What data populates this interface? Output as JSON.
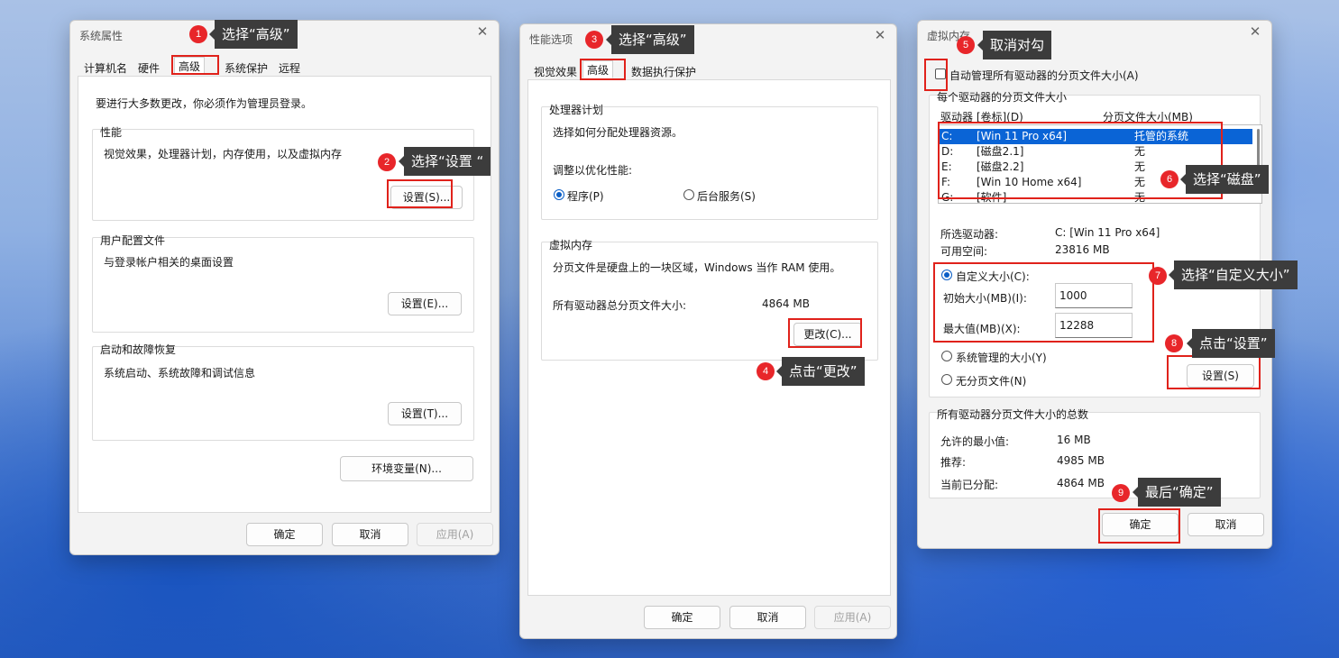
{
  "win1": {
    "title": "系统属性",
    "close": "✕",
    "tabs": [
      "计算机名",
      "硬件",
      "高级",
      "系统保护",
      "远程"
    ],
    "admin_note": "要进行大多数更改，你必须作为管理员登录。",
    "perf": {
      "title": "性能",
      "desc": "视觉效果，处理器计划，内存使用，以及虚拟内存",
      "button": "设置(S)..."
    },
    "profile": {
      "title": "用户配置文件",
      "desc": "与登录帐户相关的桌面设置",
      "button": "设置(E)..."
    },
    "startup": {
      "title": "启动和故障恢复",
      "desc": "系统启动、系统故障和调试信息",
      "button": "设置(T)..."
    },
    "env_button": "环境变量(N)...",
    "ok": "确定",
    "cancel": "取消",
    "apply": "应用(A)"
  },
  "win2": {
    "title": "性能选项",
    "close": "✕",
    "tabs": [
      "视觉效果",
      "高级",
      "数据执行保护"
    ],
    "sched": {
      "title": "处理器计划",
      "desc": "选择如何分配处理器资源。",
      "adjust": "调整以优化性能:",
      "opt_programs": "程序(P)",
      "opt_background": "后台服务(S)"
    },
    "vm": {
      "title": "虚拟内存",
      "desc": "分页文件是硬盘上的一块区域，Windows 当作 RAM 使用。",
      "total_label": "所有驱动器总分页文件大小:",
      "total_value": "4864 MB",
      "button": "更改(C)..."
    },
    "ok": "确定",
    "cancel": "取消",
    "apply": "应用(A)"
  },
  "win3": {
    "title": "虚拟内存",
    "close": "✕",
    "auto_manage": "自动管理所有驱动器的分页文件大小(A)",
    "per_drive": "每个驱动器的分页文件大小",
    "col_drive": "驱动器 [卷标](D)",
    "col_size": "分页文件大小(MB)",
    "drives": [
      {
        "letter": "C:",
        "label": "[Win 11 Pro x64]",
        "size": "托管的系统"
      },
      {
        "letter": "D:",
        "label": "[磁盘2.1]",
        "size": "无"
      },
      {
        "letter": "E:",
        "label": "[磁盘2.2]",
        "size": "无"
      },
      {
        "letter": "F:",
        "label": "[Win 10 Home x64]",
        "size": "无"
      },
      {
        "letter": "G:",
        "label": "[软件]",
        "size": "无"
      }
    ],
    "selected_label": "所选驱动器:",
    "selected_value": "C:  [Win 11 Pro x64]",
    "free_label": "可用空间:",
    "free_value": "23816 MB",
    "custom": "自定义大小(C):",
    "initial_label": "初始大小(MB)(I):",
    "initial_value": "1000",
    "max_label": "最大值(MB)(X):",
    "max_value": "12288",
    "system_managed": "系统管理的大小(Y)",
    "no_paging": "无分页文件(N)",
    "set_button": "设置(S)",
    "totals_title": "所有驱动器分页文件大小的总数",
    "min_label": "允许的最小值:",
    "min_value": "16 MB",
    "rec_label": "推荐:",
    "rec_value": "4985 MB",
    "cur_label": "当前已分配:",
    "cur_value": "4864 MB",
    "ok": "确定",
    "cancel": "取消"
  },
  "annotations": [
    {
      "num": "1",
      "text": "选择“高级”"
    },
    {
      "num": "2",
      "text": "选择“设置 “"
    },
    {
      "num": "3",
      "text": "选择“高级”"
    },
    {
      "num": "4",
      "text": "点击“更改”"
    },
    {
      "num": "5",
      "text": "取消对勾"
    },
    {
      "num": "6",
      "text": "选择“磁盘”"
    },
    {
      "num": "7",
      "text": "选择“自定义大小”"
    },
    {
      "num": "8",
      "text": "点击“设置”"
    },
    {
      "num": "9",
      "text": "最后“确定”"
    }
  ],
  "colors": {
    "highlight": "#e0221b",
    "badge": "#e8262a",
    "callout_bg": "#3c3c3c",
    "selection": "#0a64d6"
  }
}
